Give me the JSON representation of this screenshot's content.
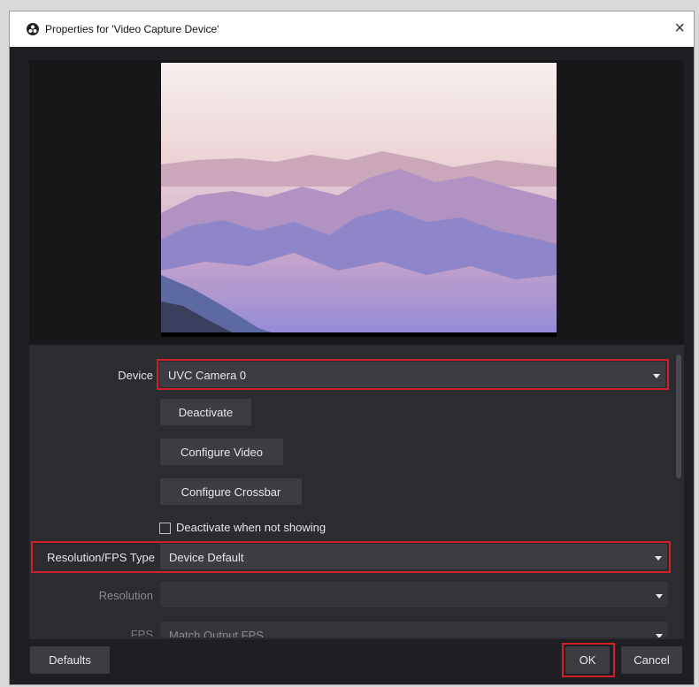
{
  "window": {
    "title": "Properties for 'Video Capture Device'",
    "close_glyph": "×"
  },
  "form": {
    "device_label": "Device",
    "device_value": "UVC Camera 0",
    "deactivate_label": "Deactivate",
    "configure_video_label": "Configure Video",
    "configure_crossbar_label": "Configure Crossbar",
    "deactivate_when_not_showing_label": "Deactivate when not showing",
    "resolution_fps_type_label": "Resolution/FPS Type",
    "resolution_fps_type_value": "Device Default",
    "resolution_label": "Resolution",
    "resolution_value": "",
    "fps_label": "FPS",
    "fps_value": "Match Output FPS"
  },
  "footer": {
    "defaults_label": "Defaults",
    "ok_label": "OK",
    "cancel_label": "Cancel"
  },
  "colors": {
    "highlight": "#d2202b",
    "dialog_bg": "#2b2b30",
    "control_bg": "#3c3c43"
  }
}
